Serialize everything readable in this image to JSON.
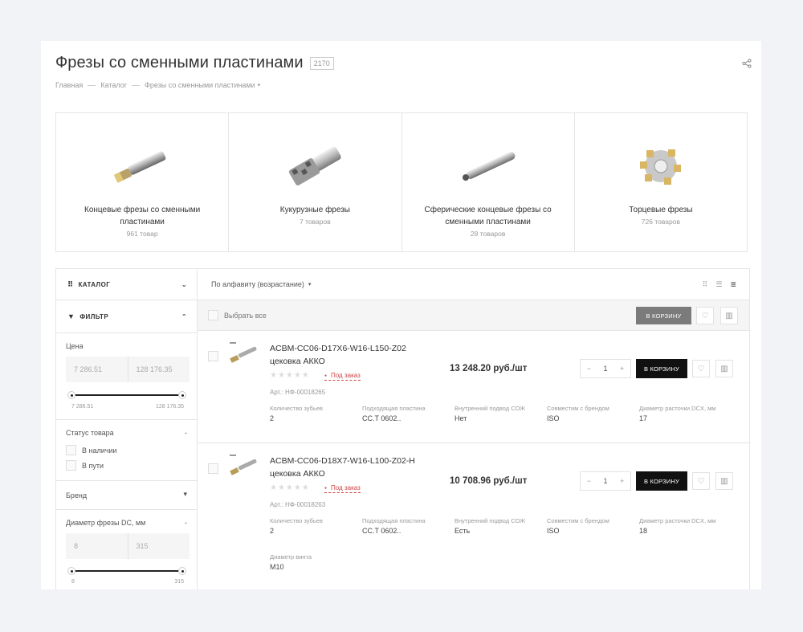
{
  "header": {
    "title": "Фрезы со сменными пластинами",
    "count": "2170"
  },
  "breadcrumbs": [
    "Главная",
    "Каталог",
    "Фрезы со сменными пластинами"
  ],
  "categories": [
    {
      "name": "Концевые фрезы со сменными пластинами",
      "count": "961 товар"
    },
    {
      "name": "Кукурузные фрезы",
      "count": "7 товаров"
    },
    {
      "name": "Сферические концевые фрезы со сменными пластинами",
      "count": "28 товаров"
    },
    {
      "name": "Торцевые фрезы",
      "count": "726 товаров"
    }
  ],
  "sidebar": {
    "catalog_label": "Каталог",
    "filter_label": "Фильтр",
    "price": {
      "label": "Цена",
      "min": "7 286.51",
      "max": "128 176.35",
      "min_label": "7 286.51",
      "max_label": "128 176.35"
    },
    "status": {
      "label": "Статус товара",
      "options": [
        "В наличии",
        "В пути"
      ]
    },
    "brand_label": "Бренд",
    "diameter": {
      "label": "Диаметр фрезы DC, мм",
      "min": "8",
      "max": "315",
      "min_label": "8",
      "max_label": "315"
    }
  },
  "toolbar": {
    "sort_label": "По алфавиту (возрастание)",
    "select_all": "Выбрать все",
    "cart_button": "В корзину"
  },
  "products": [
    {
      "title": "ACBM-CC06-D17X6-W16-L150-Z02 цековка АККО",
      "availability": "Под заказ",
      "article": "Арт.: НФ-00018265",
      "price": "13 248.20 руб./шт",
      "qty": "1",
      "cart": "В корзину",
      "props": [
        {
          "name": "Количество зубьев",
          "value": "2"
        },
        {
          "name": "Подходящая пластина",
          "value": "CC.T 0602.."
        },
        {
          "name": "Внутренний подвод СОЖ",
          "value": "Нет"
        },
        {
          "name": "Совместим с брендом",
          "value": "ISO"
        },
        {
          "name": "Диаметр расточки DCX, мм",
          "value": "17"
        }
      ]
    },
    {
      "title": "ACBM-CC06-D18X7-W16-L100-Z02-H цековка АККО",
      "availability": "Под заказ",
      "article": "Арт.: НФ-00018263",
      "price": "10 708.96 руб./шт",
      "qty": "1",
      "cart": "В корзину",
      "props": [
        {
          "name": "Количество зубьев",
          "value": "2"
        },
        {
          "name": "Подходящая пластина",
          "value": "CC.T 0602.."
        },
        {
          "name": "Внутренний подвод СОЖ",
          "value": "Есть"
        },
        {
          "name": "Совместим с брендом",
          "value": "ISO"
        },
        {
          "name": "Диаметр расточки DCX, мм",
          "value": "18"
        }
      ],
      "extra_prop": {
        "name": "Диаметр винта",
        "value": "M10"
      }
    }
  ],
  "icons": {
    "share": "share-icon",
    "catalog": "grid-dots-icon",
    "filter": "funnel-icon",
    "favorite": "heart-icon",
    "compare": "bar-chart-icon",
    "view_tile": "tile-view-icon",
    "view_list": "list-view-icon",
    "view_table": "table-view-icon"
  },
  "colors": {
    "background": "#f2f3f6",
    "cart_button": "#111111",
    "cart_button_disabled": "#7b7b7b",
    "availability": "#cc4444"
  }
}
